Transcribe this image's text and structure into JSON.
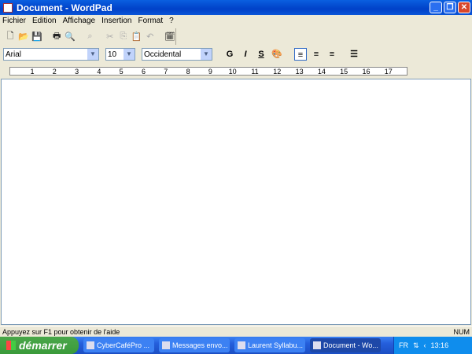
{
  "window": {
    "title": "Document - WordPad"
  },
  "menu": [
    "Fichier",
    "Edition",
    "Affichage",
    "Insertion",
    "Format",
    "?"
  ],
  "toolbar": [
    {
      "name": "new-icon",
      "glyph": "🗋",
      "disabled": false
    },
    {
      "name": "open-icon",
      "glyph": "📂",
      "disabled": false
    },
    {
      "name": "save-icon",
      "glyph": "💾",
      "disabled": false
    },
    {
      "name": "sep"
    },
    {
      "name": "print-icon",
      "glyph": "🖶",
      "disabled": false
    },
    {
      "name": "print-preview-icon",
      "glyph": "🔍",
      "disabled": false
    },
    {
      "name": "sep"
    },
    {
      "name": "find-icon",
      "glyph": "⌕",
      "disabled": true
    },
    {
      "name": "sep"
    },
    {
      "name": "cut-icon",
      "glyph": "✂",
      "disabled": true
    },
    {
      "name": "copy-icon",
      "glyph": "⎘",
      "disabled": true
    },
    {
      "name": "paste-icon",
      "glyph": "📋",
      "disabled": false
    },
    {
      "name": "undo-icon",
      "glyph": "↶",
      "disabled": true
    },
    {
      "name": "sep"
    },
    {
      "name": "date-time-icon",
      "glyph": "🗓",
      "disabled": false
    }
  ],
  "format": {
    "font": "Arial",
    "size": "10",
    "script": "Occidental",
    "bold": "G",
    "italic": "I",
    "underline": "S",
    "color_glyph": "🎨"
  },
  "ruler": [
    "1",
    "2",
    "3",
    "4",
    "5",
    "6",
    "7",
    "8",
    "9",
    "10",
    "11",
    "12",
    "13",
    "14",
    "15",
    "16",
    "17"
  ],
  "status": {
    "help": "Appuyez sur F1 pour obtenir de l'aide",
    "num": "NUM"
  },
  "taskbar": {
    "start": "démarrer",
    "tasks": [
      "CyberCaféPro ...",
      "Messages envo...",
      "Laurent Syllabu...",
      "Document - Wo..."
    ],
    "lang": "FR",
    "clock": "13:16"
  }
}
